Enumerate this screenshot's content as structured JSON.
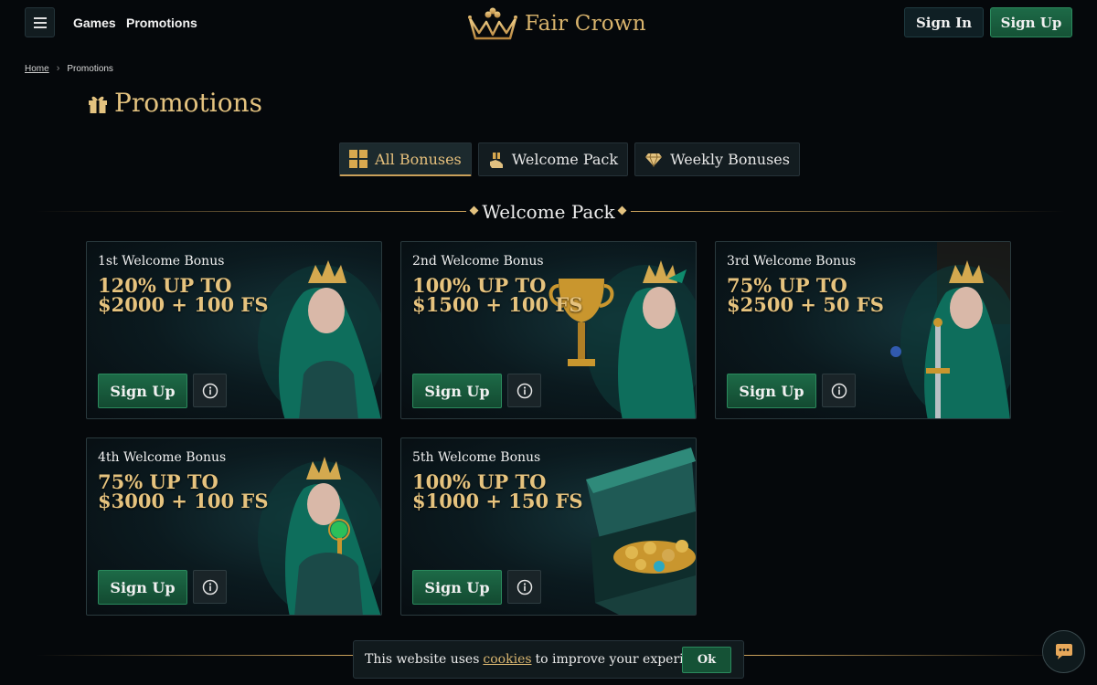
{
  "header": {
    "nav": [
      "Games",
      "Promotions"
    ],
    "logo_text": "Fair Crown",
    "sign_in": "Sign In",
    "sign_up": "Sign Up"
  },
  "breadcrumb": {
    "home": "Home",
    "current": "Promotions"
  },
  "page_title": "Promotions",
  "tabs": [
    {
      "label": "All Bonuses",
      "icon": "grid-icon",
      "active": true
    },
    {
      "label": "Welcome Pack",
      "icon": "hand-gift-icon",
      "active": false
    },
    {
      "label": "Weekly Bonuses",
      "icon": "diamond-icon",
      "active": false
    }
  ],
  "section_title": "Welcome Pack",
  "cards": [
    {
      "title": "1st Welcome Bonus",
      "offer": "120% UP TO $2000 + 100 FS",
      "button": "Sign Up",
      "art": "elf-queen"
    },
    {
      "title": "2nd Welcome Bonus",
      "offer": "100% UP TO $1500 + 100 FS",
      "button": "Sign Up",
      "art": "elf-queen-trophy"
    },
    {
      "title": "3rd Welcome Bonus",
      "offer": "75% UP TO $2500 + 50 FS",
      "button": "Sign Up",
      "art": "elf-queen-sword"
    },
    {
      "title": "4th Welcome Bonus",
      "offer": "75% UP TO $3000 + 100 FS",
      "button": "Sign Up",
      "art": "elf-queen-scepter"
    },
    {
      "title": "5th Welcome Bonus",
      "offer": "100% UP TO $1000 + 150 FS",
      "button": "Sign Up",
      "art": "treasure-chest"
    }
  ],
  "cookie": {
    "text_before": "This website uses",
    "link": "cookies",
    "text_after": "to improve your experience.",
    "ok": "Ok"
  },
  "colors": {
    "gold": "#e3c27f",
    "green": "#1d6a47",
    "bg": "#05080b"
  }
}
